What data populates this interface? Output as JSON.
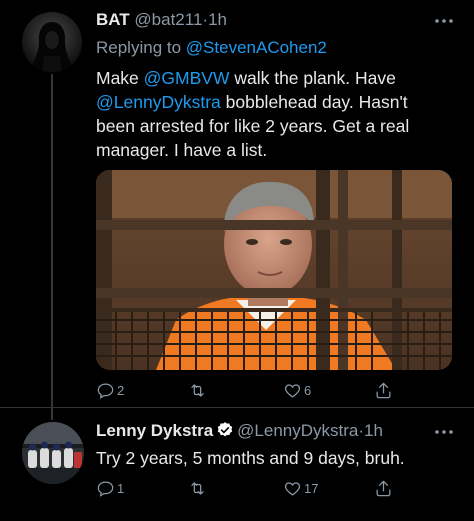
{
  "tweets": [
    {
      "display_name": "BAT",
      "handle": "@bat211",
      "separator": "·",
      "time": "1h",
      "replying_label": "Replying to",
      "replying_to": "@StevenACohen2",
      "lines": [
        [
          "Make ",
          "@GMBVW",
          " walk the plank. Have"
        ],
        [
          "@LennyDykstra",
          " bobblehead day. Hasn't"
        ],
        [
          "been arrested for like 2 years. Get a real"
        ],
        [
          "manager. I have a list."
        ]
      ],
      "has_image": true,
      "reply_count": "2",
      "retweet_count": "",
      "like_count": "6",
      "avatar_icon": "hooded-figure-avatar"
    },
    {
      "display_name": "Lenny Dykstra",
      "verified": true,
      "handle": "@LennyDykstra",
      "separator": "·",
      "time": "1h",
      "text": "Try 2 years, 5 months and 9 days, bruh.",
      "reply_count": "1",
      "retweet_count": "",
      "like_count": "17",
      "avatar_icon": "baseball-team-photo-avatar"
    }
  ],
  "more_icon": "ellipsis-icon",
  "colors": {
    "background": "#000000",
    "text": "#e7e9ea",
    "muted": "#8b98a5",
    "link": "#1d9bf0",
    "verified": "#ffffff",
    "divider": "#2f3336"
  }
}
